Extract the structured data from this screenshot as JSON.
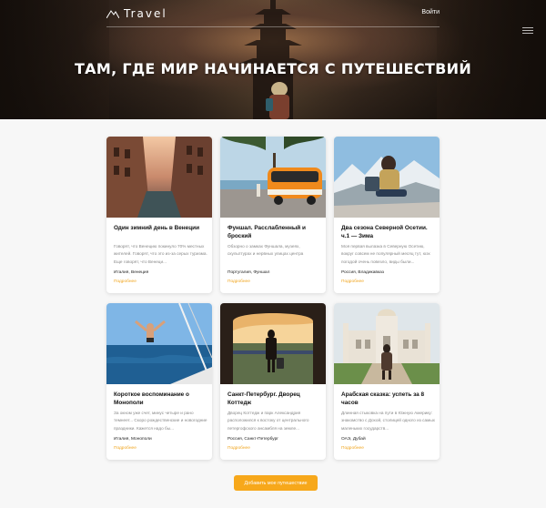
{
  "header": {
    "logo_text": "Travel",
    "login_label": "Войти",
    "hero_title": "ТАМ, ГДЕ МИР НАЧИНАЕТСЯ С ПУТЕШЕСТВИЙ"
  },
  "cards": [
    {
      "title": "Один зимний день в Венеции",
      "description": "Говорят, что Венецию покинуло 70% местных жителей. Говорят, что это из-за серых туризма. Еще говорят, что Венеци...",
      "location": "Италия, Венеция",
      "more_label": "Подробнее"
    },
    {
      "title": "Фуншал. Расслабленный и броский",
      "description": "Обзорно о замках Фуншала, музеях, скульптурах и нервных улицах центра",
      "location": "Португалия, Фуншал",
      "more_label": "Подробнее"
    },
    {
      "title": "Два сезона Северной Осетии. ч.1 — Зима",
      "description": "Моя первая вылазка в Северную Осетию, вокруг совсем не популярный месяц тут, юэх погодой очень повезло, виды были...",
      "location": "Россия, Владикавказ",
      "more_label": "Подробнее"
    },
    {
      "title": "Короткое воспоминание о Монополи",
      "description": "За окном уже счет, минус четыре и рано темнеет... Скоро рождественские и новогодние праздники. Кажется надо бы...",
      "location": "Италия, Монополи",
      "more_label": "Подробнее"
    },
    {
      "title": "Санкт-Петербург. Дворец Коттедж",
      "description": "Дворец Коттедж и парк Александрия расположился к востоку от центрального петергофского ансамбля на земле...",
      "location": "Россия, Санкт-Петербург",
      "more_label": "Подробнее"
    },
    {
      "title": "Арабская сказка: успеть за 8 часов",
      "description": "Длинная стыковка на пути в Южную Америку: знакомство с Дохой, столицей одного из самых маленьких государств...",
      "location": "ОАЭ, Дубай",
      "more_label": "Подробнее"
    }
  ],
  "add_button_label": "Добавить мое путешествие",
  "colors": {
    "accent": "#f7a81b",
    "link": "#f0a51f",
    "background": "#f7f7f7"
  }
}
